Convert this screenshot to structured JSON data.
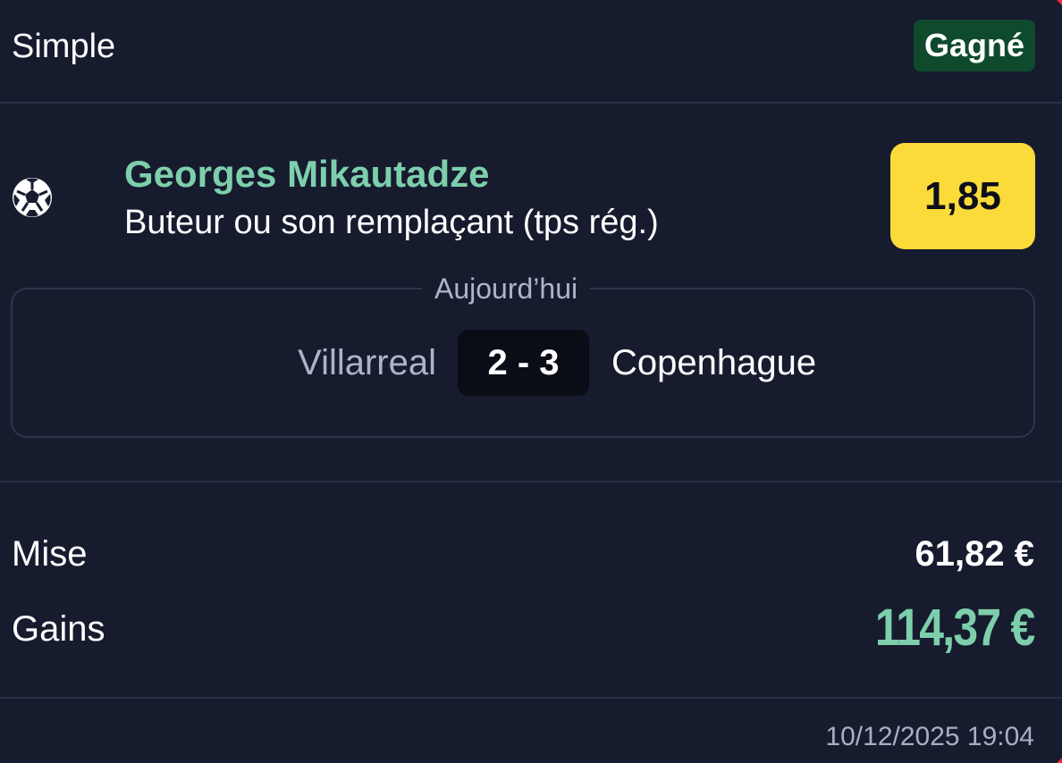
{
  "header": {
    "bet_type": "Simple",
    "status": "Gagné"
  },
  "selection": {
    "sport_icon": "soccer-ball-icon",
    "name": "Georges Mikautadze",
    "market": "Buteur ou son remplaçant (tps rég.)",
    "odds": "1,85"
  },
  "match": {
    "date": "Aujourd’hui",
    "home_team": "Villarreal",
    "score": "2 - 3",
    "away_team": "Copenhague"
  },
  "summary": {
    "stake_label": "Mise",
    "stake_value": "61,82 €",
    "gains_label": "Gains",
    "gains_value": "114,37 €"
  },
  "footer": {
    "timestamp": "10/12/2025 19:04"
  },
  "colors": {
    "background": "#171b2e",
    "accent_green": "#7dcfab",
    "status_badge_bg": "#0f4a2c",
    "odds_yellow": "#fadb3a",
    "score_bg": "#0a0c16"
  }
}
